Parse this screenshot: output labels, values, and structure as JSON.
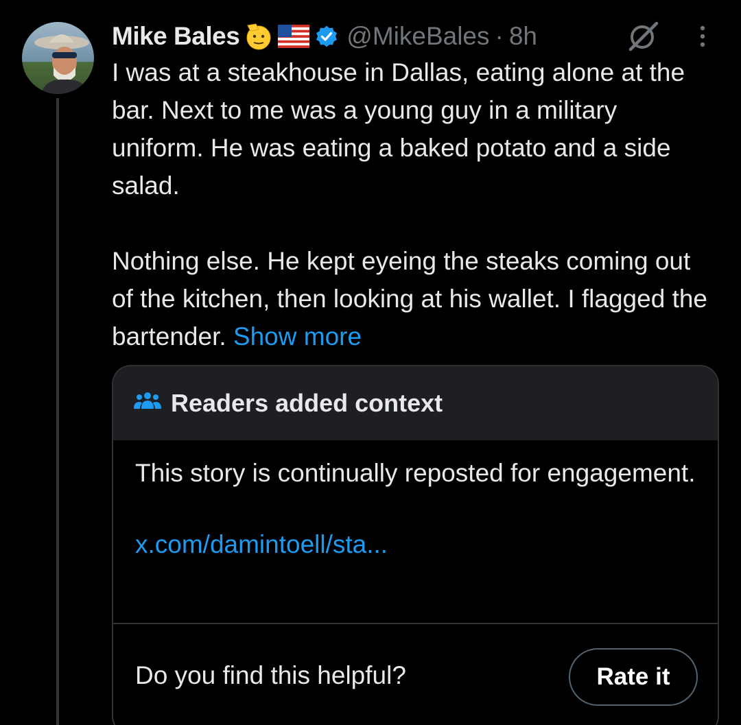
{
  "tweet": {
    "author": {
      "name": "Mike Bales",
      "emojis": [
        "saluting-face",
        "us-flag"
      ],
      "verified": true,
      "handle": "@MikeBales",
      "separator": "·",
      "time": "8h"
    },
    "text": {
      "para1": "I was at a steakhouse in Dallas, eating alone at the bar. Next to me was a young guy in a military uniform. He was eating a baked potato and a side salad.",
      "para2": "Nothing else. He kept eyeing the steaks coming out of the kitchen, then looking at his wallet. I flagged the bartender.",
      "show_more": "Show more"
    },
    "community_note": {
      "title": "Readers added context",
      "body": "This story is continually reposted for engagement.",
      "link": "x.com/damintoell/sta...",
      "question": "Do you find this helpful?",
      "rate_label": "Rate it"
    }
  },
  "colors": {
    "background": "#000000",
    "text": "#e7e9ea",
    "muted": "#71767b",
    "accent_blue": "#1d9bf0",
    "note_header_bg": "#1d1f23",
    "border": "#2f3336"
  },
  "icons": {
    "note_header": "people-group-icon",
    "verified": "verified-badge-icon",
    "grok": "grok-icon",
    "more": "more-options-icon"
  }
}
